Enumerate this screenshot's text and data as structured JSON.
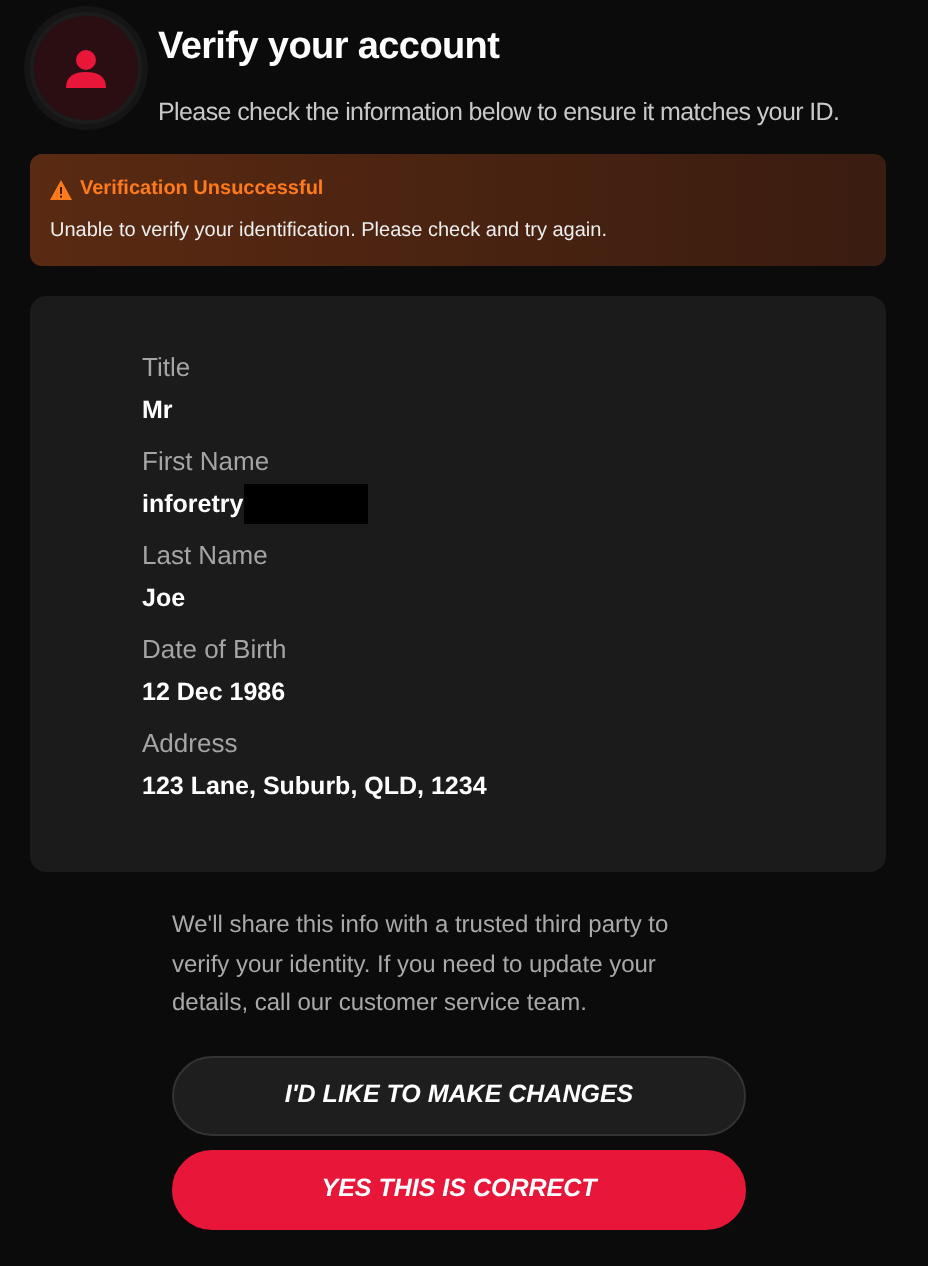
{
  "header": {
    "title": "Verify your account",
    "subtitle": "Please check the information below to ensure it matches your ID."
  },
  "alert": {
    "title": "Verification Unsuccessful",
    "message": "Unable to verify your identification. Please check and try again."
  },
  "details": [
    {
      "label": "Title",
      "value": "Mr",
      "redacted": false
    },
    {
      "label": "First Name",
      "value": "inforetry",
      "redacted": true
    },
    {
      "label": "Last Name",
      "value": "Joe",
      "redacted": false
    },
    {
      "label": "Date of Birth",
      "value": "12 Dec 1986",
      "redacted": false
    },
    {
      "label": "Address",
      "value": "123 Lane, Suburb, QLD, 1234",
      "redacted": false
    }
  ],
  "note": "We'll share this info with a trusted third party to verify your identity. If you need to update your details, call our customer service team.",
  "buttons": [
    {
      "label": "I'D LIKE TO MAKE CHANGES",
      "kind": "secondary"
    },
    {
      "label": "YES THIS IS CORRECT",
      "kind": "primary"
    }
  ]
}
